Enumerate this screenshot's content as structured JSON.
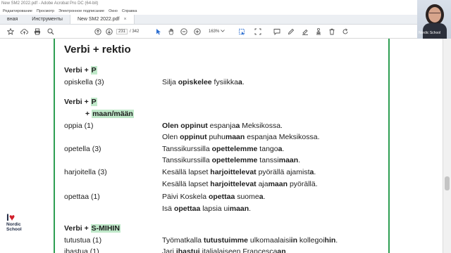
{
  "window": {
    "title": "New SM2 2022.pdf - Adobe Acrobat Pro DC (64-bit)"
  },
  "menu": [
    "Редактирование",
    "Просмотр",
    "Электронное подписание",
    "Окно",
    "Справка"
  ],
  "tabs": [
    {
      "label": "вная"
    },
    {
      "label": "Инструменты"
    },
    {
      "label": "New SM2 2022.pdf",
      "close": "×"
    }
  ],
  "toolbar": {
    "page_current": "231",
    "page_total": "/ 342",
    "zoom": "163%",
    "icons": [
      "star-icon",
      "cloud-upload-icon",
      "print-icon",
      "search-icon",
      "page-up-icon",
      "page-down-icon",
      "select-cursor-icon",
      "hand-icon",
      "zoom-out-icon",
      "zoom-in-icon",
      "zoom-dropdown-icon",
      "marquee-icon",
      "fit-page-icon",
      "comment-icon",
      "pen-icon",
      "highlight-icon",
      "stamp-icon",
      "delete-icon",
      "rotate-icon"
    ]
  },
  "webcam": {
    "label": "Nordic School"
  },
  "logo": {
    "line1": "I",
    "heart": "♥",
    "line2": "Nordic",
    "line3": "School"
  },
  "document": {
    "title": "Verbi + rektio",
    "sections": [
      {
        "head": "Verbi + ",
        "tag": "P"
      },
      {
        "head": "Verbi + ",
        "tag": "P",
        "sub_plus": "+ ",
        "sub_tag": "maan/mään"
      },
      {
        "head": "Verbi + ",
        "tag": "S-MIHIN"
      }
    ],
    "rows": {
      "opiskella": {
        "verb": "opiskella (3)",
        "ex1": [
          "Silja ",
          "opiskelee",
          " fysiikka",
          "a",
          "."
        ]
      },
      "oppia": {
        "verb": "oppia (1)",
        "ex1": [
          "Olen oppinut",
          " espanja",
          "a",
          " Meksikossa."
        ],
        "ex2": [
          "Olen ",
          "oppinut",
          " puhu",
          "maan",
          " espanjaa Meksikossa."
        ]
      },
      "opetella": {
        "verb": "opetella (3)",
        "ex1": [
          "Tanssikurssilla ",
          "opettelemme",
          " tango",
          "a",
          "."
        ],
        "ex2": [
          "Tanssikurssilla ",
          "opettelemme",
          " tanssi",
          "maan",
          "."
        ]
      },
      "harjoitella": {
        "verb": "harjoitella (3)",
        "ex1": [
          "Kesällä lapset ",
          "harjoittelevat",
          " pyörällä ajamist",
          "a",
          "."
        ],
        "ex2": [
          "Kesällä lapset ",
          "harjoittelevat",
          " aja",
          "maan",
          " pyörällä."
        ]
      },
      "opettaa": {
        "verb": "opettaa (1)",
        "ex1": [
          "Päivi Koskela ",
          "opettaa",
          " suome",
          "a",
          "."
        ],
        "ex2": [
          "Isä ",
          "opettaa",
          " lapsia ui",
          "maan",
          "."
        ]
      },
      "tutustua": {
        "verb": "tutustua (1)",
        "ex1": [
          "Työmatkalla ",
          "tutustuimme",
          " ulkomaalaisi",
          "in",
          " kollegoi",
          "hin",
          "."
        ]
      },
      "ihastua": {
        "verb": "ihastua (1)",
        "ex1": [
          "Jari ",
          "ihastui",
          " italialaiseen Francesca",
          "an",
          "."
        ]
      }
    }
  }
}
